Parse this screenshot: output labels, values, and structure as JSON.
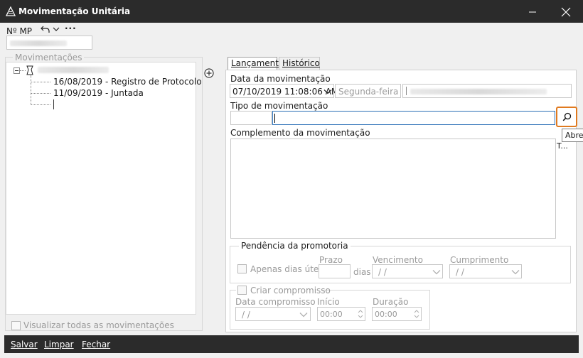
{
  "window": {
    "title": "Movimentação Unitária",
    "controls": [
      "minimize-icon",
      "close-icon"
    ]
  },
  "header": {
    "mp_label": "Nº MP",
    "undo_icon": "undo-icon",
    "more_icon": "more-icon"
  },
  "left": {
    "group_title": "Movimentações",
    "tree_items": [
      "16/08/2019 - Registro de Protocolo",
      "11/09/2019 - Juntada"
    ],
    "show_all_label": "Visualizar todas as movimentações"
  },
  "tabs": [
    {
      "label": "Lançamento",
      "active": true
    },
    {
      "label": "Histórico",
      "active": false
    }
  ],
  "form": {
    "data_label": "Data da movimentação",
    "data_value": "07/10/2019 11:08:06 AM",
    "weekday_placeholder": "Segunda-feira",
    "tipo_label": "Tipo de movimentação",
    "tipo_value": "",
    "search_tooltip": "Abre",
    "search_icon": "search-icon",
    "complemento_label": "Complemento da movimentação",
    "truncated_label": "T...",
    "pendencia": {
      "title": "Pendência da promotoria",
      "apenas_label": "Apenas dias úteis?",
      "prazo_label": "Prazo",
      "dias_label": "dias",
      "vencimento_label": "Vencimento",
      "vencimento_value": "/ /",
      "cumprimento_label": "Cumprimento",
      "cumprimento_value": "/ /"
    },
    "compromisso": {
      "title": "Criar compromisso",
      "data_label": "Data compromisso",
      "data_value": "/ /",
      "inicio_label": "Início",
      "inicio_value": "00:00",
      "duracao_label": "Duração",
      "duracao_value": "00:00"
    }
  },
  "footer": {
    "save_label": "Salvar",
    "clear_label": "Limpar",
    "close_label": "Fechar"
  },
  "colors": {
    "titlebar": "#2b2b2b",
    "focus_border": "#2b6fb6",
    "search_highlight": "#e07a1f"
  }
}
